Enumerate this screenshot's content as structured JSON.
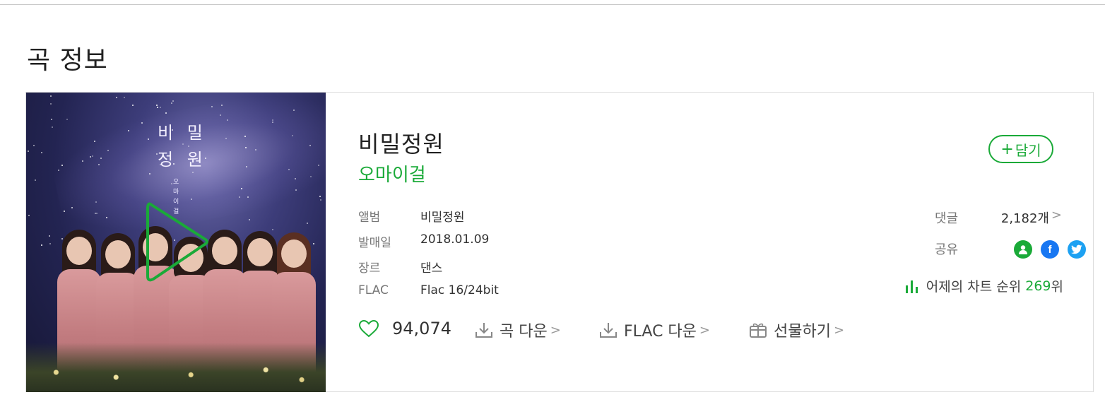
{
  "section": {
    "title": "곡 정보"
  },
  "album_art": {
    "title_line1": "비 밀",
    "title_line2": "정 원",
    "subtitle": "오마이걸"
  },
  "song": {
    "title": "비밀정원",
    "artist": "오마이걸",
    "meta": [
      {
        "label": "앨범",
        "value": "비밀정원"
      },
      {
        "label": "발매일",
        "value": "2018.01.09"
      },
      {
        "label": "장르",
        "value": "댄스"
      },
      {
        "label": "FLAC",
        "value": "Flac 16/24bit"
      }
    ]
  },
  "actions": {
    "like_count": "94,074",
    "song_download": "곡 다운",
    "flac_download": "FLAC 다운",
    "gift": "선물하기",
    "chevron": ">"
  },
  "right": {
    "add_button": "담기",
    "add_plus": "+",
    "comment_label": "댓글",
    "comment_count": "2,182개",
    "share_label": "공유",
    "share_icons": [
      "kakao-profile-icon",
      "facebook-icon",
      "twitter-icon"
    ],
    "share_facebook_glyph": "f",
    "chart_label": "어제의 차트 순위",
    "chart_rank": "269",
    "chart_rank_suffix": "위"
  },
  "colors": {
    "accent_green": "#1aaa38",
    "facebook_blue": "#1877f2",
    "twitter_blue": "#1da1f2"
  }
}
